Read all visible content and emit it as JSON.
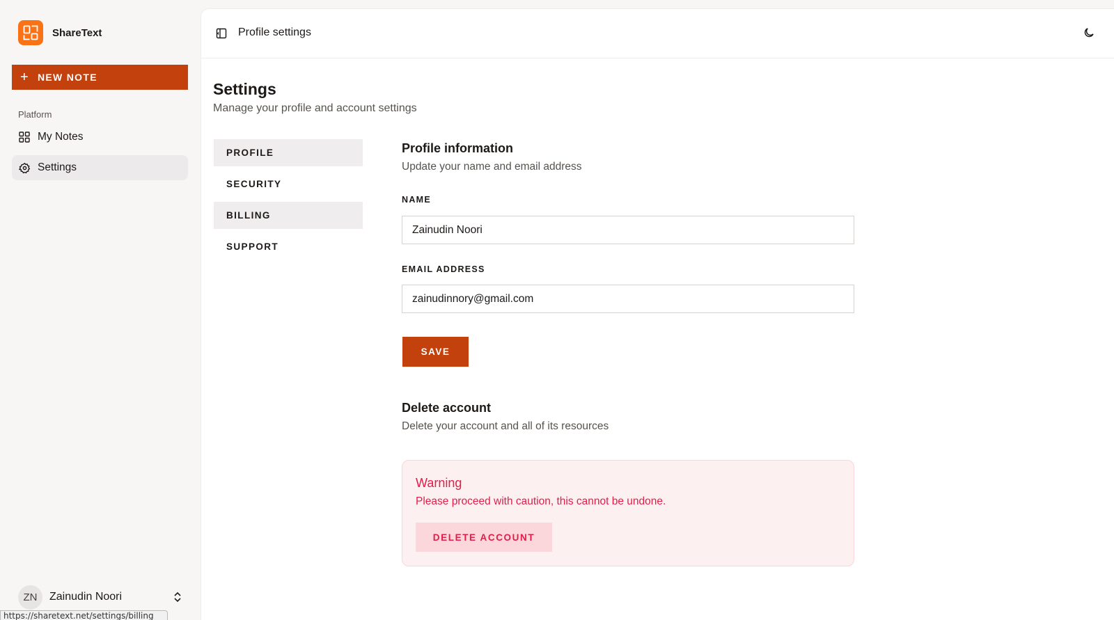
{
  "app": {
    "name": "ShareText",
    "brand_color": "#f97316",
    "accent_color": "#c2410c",
    "logo_icon": "sharetext-logo-icon"
  },
  "sidebar": {
    "new_note_label": "NEW NOTE",
    "group_label": "Platform",
    "items": [
      {
        "label": "My Notes",
        "icon": "grid-icon",
        "active": false
      },
      {
        "label": "Settings",
        "icon": "gear-icon",
        "active": true
      }
    ],
    "user": {
      "initials": "ZN",
      "name": "Zainudin Noori"
    }
  },
  "status_bar_url": "https://sharetext.net/settings/billing",
  "header": {
    "title": "Profile settings"
  },
  "page": {
    "title": "Settings",
    "subtitle": "Manage your profile and account settings"
  },
  "settings_tabs": [
    {
      "label": "PROFILE",
      "active": true
    },
    {
      "label": "SECURITY",
      "active": false
    },
    {
      "label": "BILLING",
      "active": false,
      "hovered": true
    },
    {
      "label": "SUPPORT",
      "active": false
    }
  ],
  "profile": {
    "title": "Profile information",
    "subtitle": "Update your name and email address",
    "name_label": "NAME",
    "name_value": "Zainudin Noori",
    "email_label": "EMAIL ADDRESS",
    "email_value": "zainudinnory@gmail.com",
    "save_label": "SAVE"
  },
  "delete_account": {
    "title": "Delete account",
    "subtitle": "Delete your account and all of its resources",
    "warning_title": "Warning",
    "warning_text": "Please proceed with caution, this cannot be undone.",
    "button_label": "DELETE ACCOUNT",
    "warning_color": "#e11d48"
  }
}
